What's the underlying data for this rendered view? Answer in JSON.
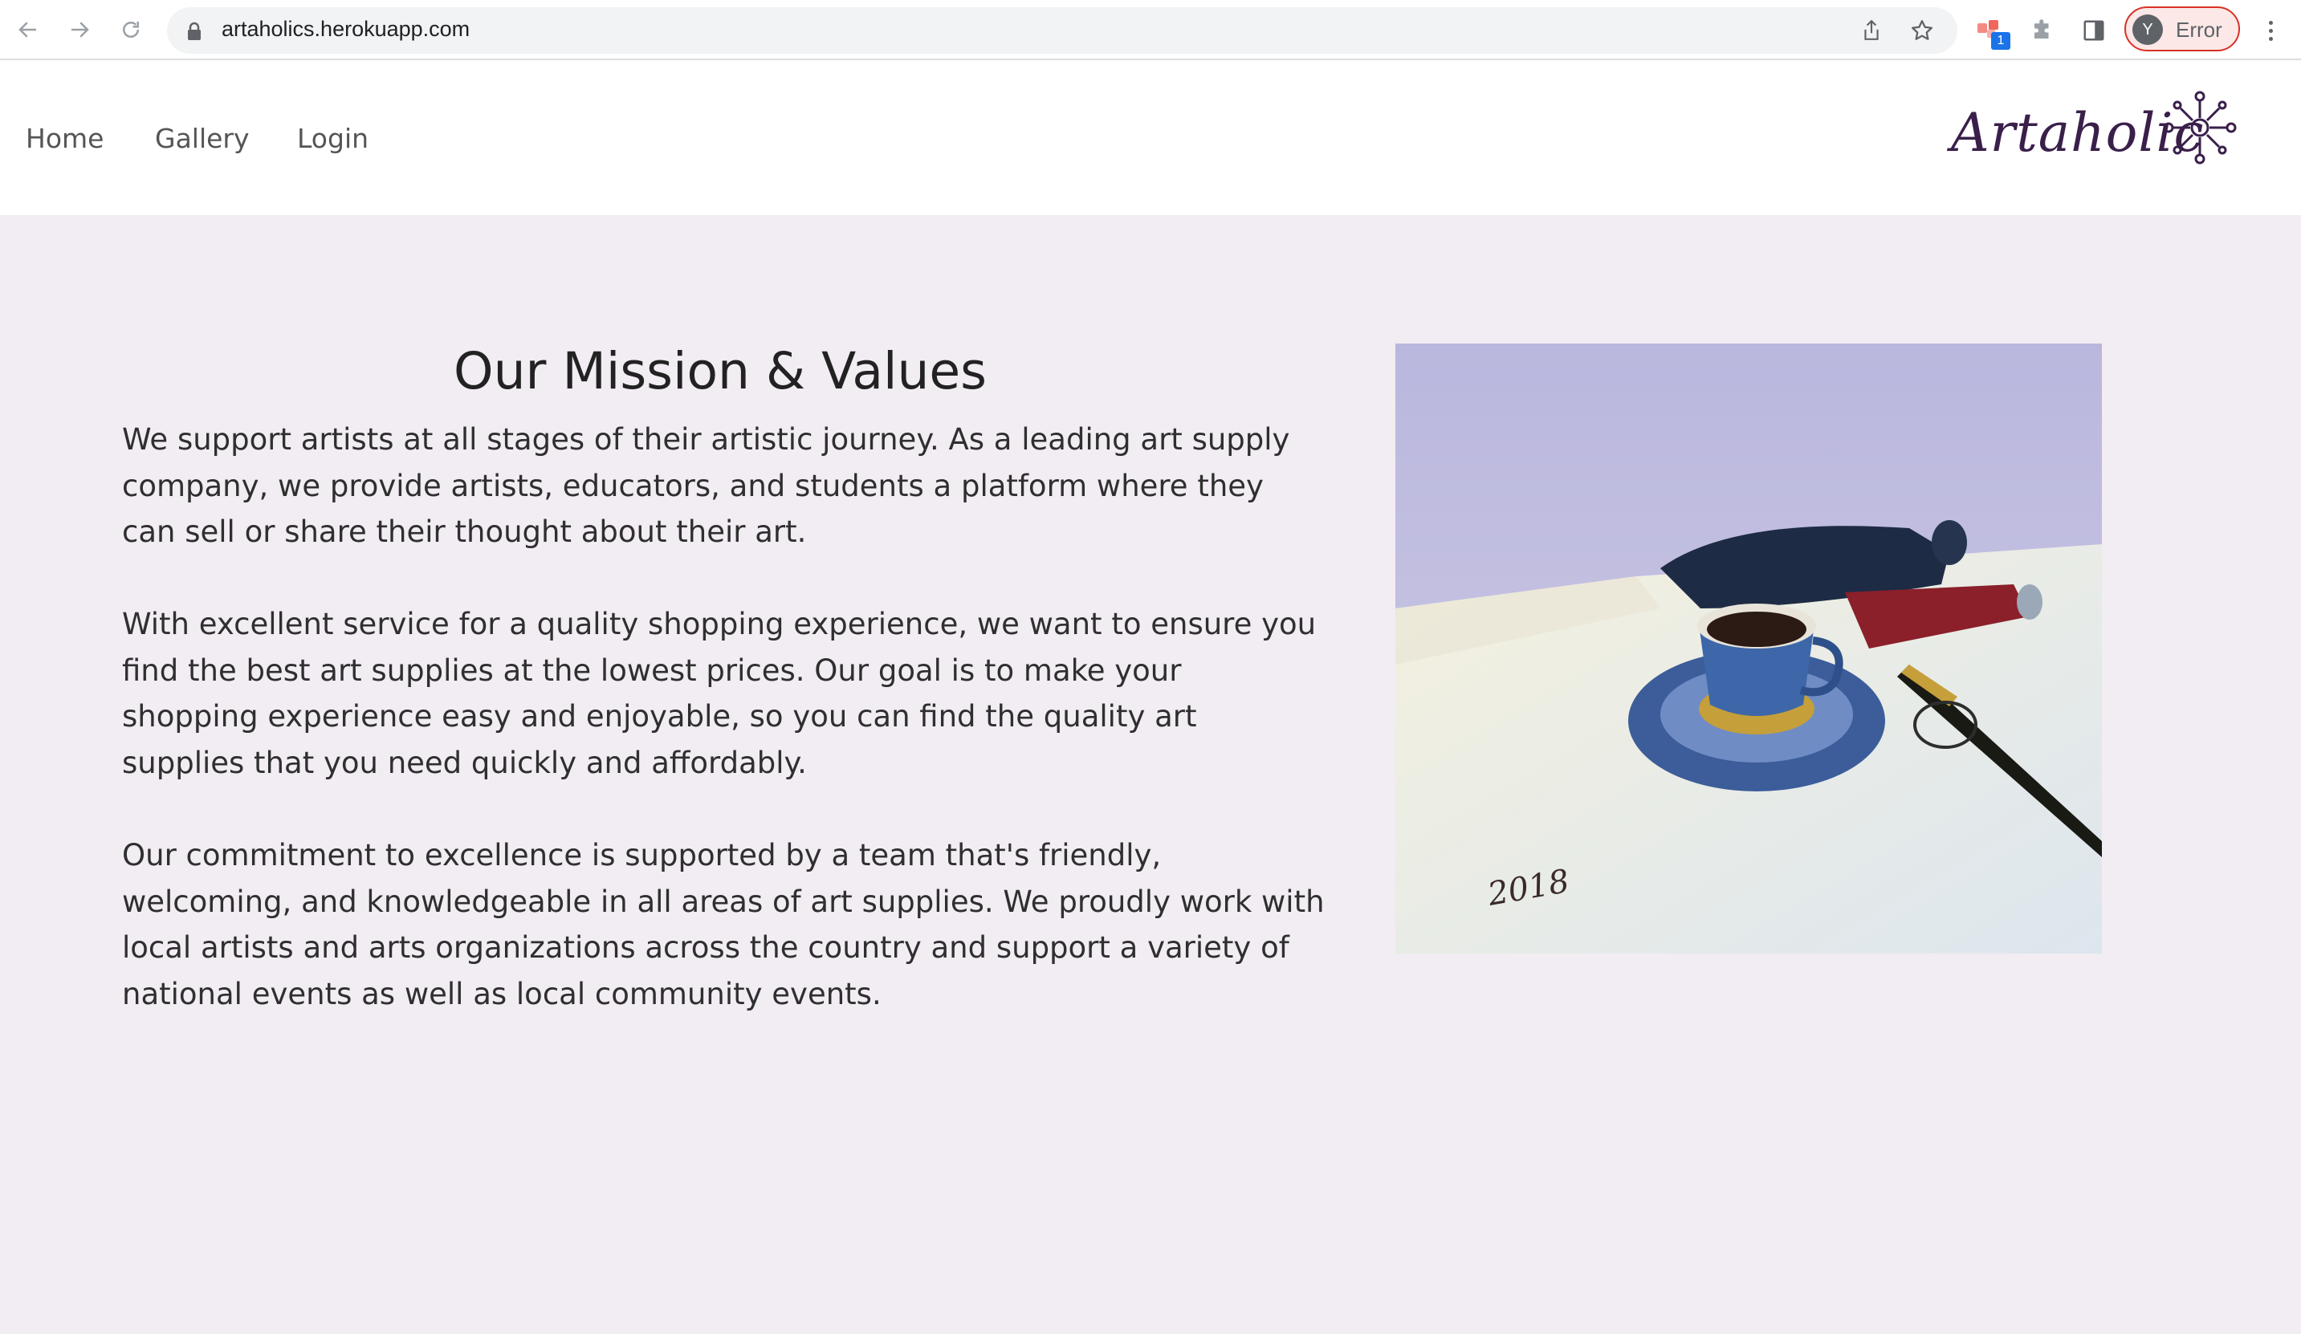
{
  "browser": {
    "url": "artaholics.herokuapp.com",
    "extension_badge": "1",
    "profile_initial": "Y",
    "profile_label": "Error",
    "icons": [
      "back-icon",
      "forward-icon",
      "reload-icon",
      "lock-icon",
      "share-icon",
      "star-icon",
      "extension-icon",
      "puzzle-icon",
      "side-panel-icon",
      "menu-icon"
    ]
  },
  "site": {
    "nav": [
      "Home",
      "Gallery",
      "Login"
    ],
    "logo_text": "Artaholic"
  },
  "main": {
    "heading": "Our Mission & Values",
    "paragraphs": [
      "We support artists at all stages of their artistic journey. As a leading art supply company, we provide artists, educators, and students a platform where they can sell or share their thought about their art.",
      "With excellent service for a quality shopping experience, we want to ensure you find the best art supplies at the lowest prices. Our goal is to make your shopping experience easy and enjoyable, so you can find the quality art supplies that you need quickly and affordably.",
      "Our commitment to excellence is supported by a team that's friendly, welcoming, and knowledgeable in all areas of art supplies. We proudly work with local artists and arts organizations across the country and support a variety of national events as well as local community events."
    ],
    "painting_signature": "2018"
  }
}
